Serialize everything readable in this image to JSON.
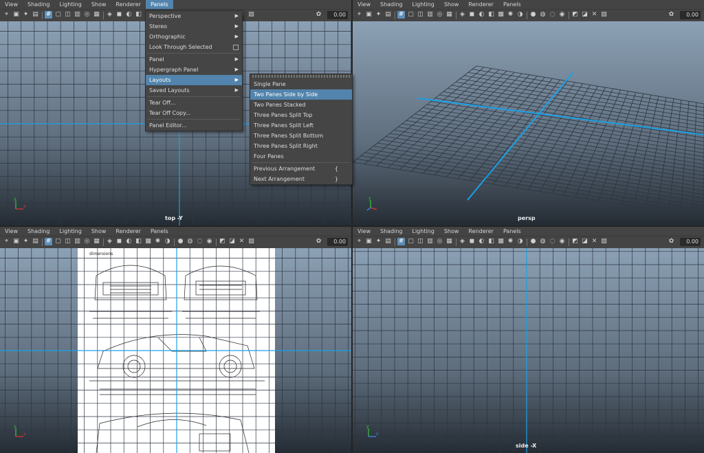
{
  "menus": [
    "View",
    "Shading",
    "Lighting",
    "Show",
    "Renderer",
    "Panels"
  ],
  "active_menu": "Panels",
  "toolbar": {
    "value": "0.00"
  },
  "panes": {
    "top_left": {
      "label": "top -Y"
    },
    "top_right": {
      "label": "persp"
    },
    "bottom_left": {
      "label": ""
    },
    "bottom_right": {
      "label": "side -X"
    }
  },
  "panels_menu": {
    "items": [
      {
        "label": "Perspective",
        "sub": true
      },
      {
        "label": "Stereo",
        "sub": true
      },
      {
        "label": "Orthographic",
        "sub": true
      },
      {
        "label": "Look Through Selected",
        "check": true
      },
      {
        "label": "Panel",
        "sub": true
      },
      {
        "label": "Hypergraph Panel",
        "sub": true
      },
      {
        "label": "Layouts",
        "sub": true,
        "highlight": true
      },
      {
        "label": "Saved Layouts",
        "sub": true
      },
      {
        "label": "Tear Off..."
      },
      {
        "label": "Tear Off Copy..."
      },
      {
        "label": "Panel Editor..."
      }
    ]
  },
  "layouts_menu": {
    "items": [
      "Single Pane",
      "Two Panes Side by Side",
      "Two Panes Stacked",
      "Three Panes Split Top",
      "Three Panes Split Left",
      "Three Panes Split Bottom",
      "Three Panes Split Right",
      "Four Panes",
      "Previous Arrangement",
      "Next Arrangement"
    ],
    "highlighted": "Two Panes Side by Side",
    "prev_key": "{",
    "next_key": "}"
  },
  "blueprint": {
    "corner_text": "dimensions"
  },
  "colors": {
    "accent": "#5284ad",
    "axis_line": "#1aa0e6",
    "grid": "#2b3440"
  }
}
